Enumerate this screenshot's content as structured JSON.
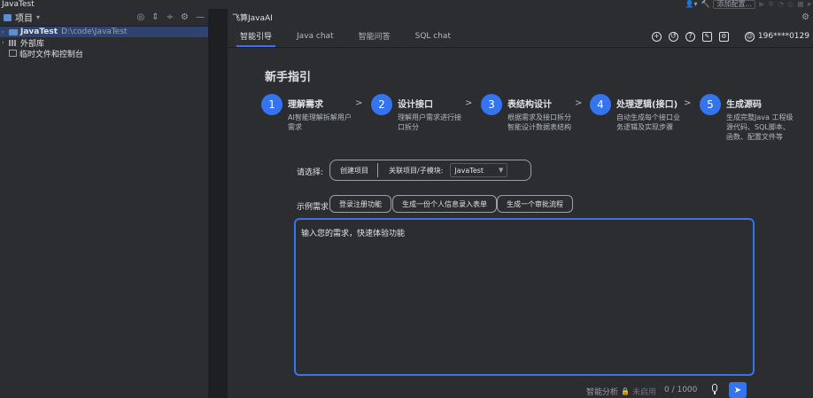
{
  "window": {
    "title": "JavaTest",
    "run_config": "添加配置..."
  },
  "project_panel": {
    "title": "项目",
    "tree": [
      {
        "name": "JavaTest",
        "path": "D:\\code\\JavaTest",
        "selected": true
      },
      {
        "name": "外部库"
      },
      {
        "name": "临时文件和控制台"
      }
    ]
  },
  "plugin": {
    "title": "飞算JavaAI",
    "tabs": [
      "智能引导",
      "Java chat",
      "智能问答",
      "SQL chat"
    ],
    "active_tab": 0,
    "user": "196****0129",
    "guide_title": "新手指引",
    "steps": [
      {
        "num": "1",
        "title": "理解需求",
        "desc": "AI智能理解拆解用户需求"
      },
      {
        "num": "2",
        "title": "设计接口",
        "desc": "理解用户需求进行接口拆分"
      },
      {
        "num": "3",
        "title": "表结构设计",
        "desc": "根据需求及接口拆分智能设计数据表结构"
      },
      {
        "num": "4",
        "title": "处理逻辑(接口)",
        "desc": "自动生成每个接口业务逻辑及实现步骤"
      },
      {
        "num": "5",
        "title": "生成源码",
        "desc": "生成完整Java 工程级源代码、SQL脚本、函数、配置文件等"
      }
    ],
    "select_label": "请选择:",
    "create_project": "创建项目",
    "module_label": "关联项目/子模块:",
    "module_value": "JavaTest",
    "examples_label": "示例需求",
    "examples": [
      "登录注册功能",
      "生成一份个人信息录入表单",
      "生成一个审批流程"
    ],
    "input_placeholder": "输入您的需求，快速体验功能",
    "smart_analysis": "智能分析",
    "smart_state": "未启用",
    "char_count": "0 / 1000"
  },
  "colors": {
    "accent": "#3574f0",
    "bg": "#2b2d30",
    "splitter": "#1e1f22"
  }
}
